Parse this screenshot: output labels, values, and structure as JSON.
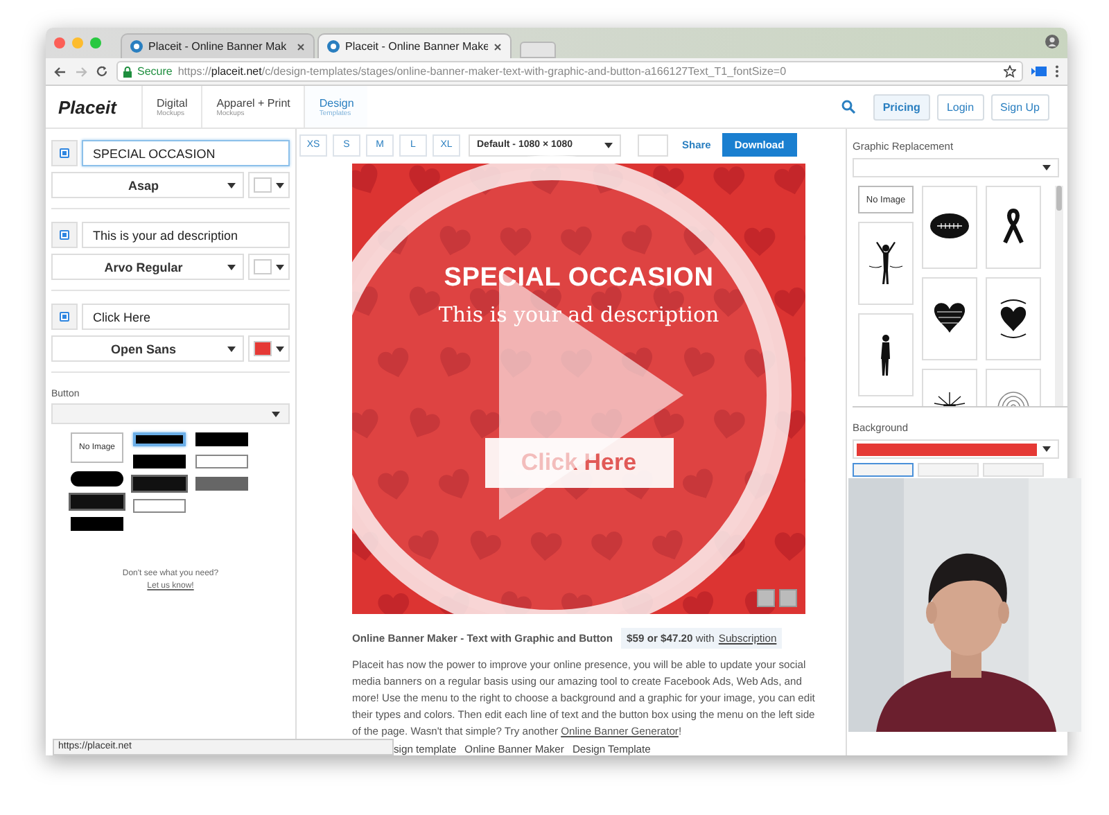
{
  "browser": {
    "tabs": [
      {
        "title": "Placeit - Online Banner Mak",
        "selected": false
      },
      {
        "title": "Placeit - Online Banner Make",
        "selected": true
      }
    ],
    "secure_label": "Secure",
    "url": "https://**placeit.net**/c/design-templates/stages/online-banner-maker-text-with-graphic-and-button-a166127Text_T1_fontSize=0"
  },
  "header": {
    "logo": "Placeit",
    "nav": [
      {
        "title": "Digital",
        "subtitle": "Mockups",
        "selected": false
      },
      {
        "title": "Apparel + Print",
        "subtitle": "Mockups",
        "selected": false
      },
      {
        "title": "Design",
        "subtitle": "Templates",
        "selected": true
      }
    ],
    "buttons": [
      {
        "label": "Pricing",
        "highlighted": true
      },
      {
        "label": "Login",
        "highlighted": false
      },
      {
        "label": "Sign Up",
        "highlighted": false
      }
    ]
  },
  "text_layers": [
    {
      "checked": true,
      "text": "SPECIAL OCCASION",
      "focused": true,
      "font": "Asap",
      "color": "#ffffff"
    },
    {
      "checked": true,
      "text": "This is your ad description",
      "focused": false,
      "font": "Arvo Regular",
      "color": "#ffffff"
    },
    {
      "checked": true,
      "text": "Click Here",
      "focused": false,
      "font": "Open Sans",
      "color": "#e53935"
    }
  ],
  "button_panel": {
    "label": "Button",
    "columns": [
      [
        {
          "kind": "no-image",
          "text": "No Image",
          "selected": false
        },
        {
          "kind": "pill",
          "selected": false
        },
        {
          "kind": "shadow",
          "selected": false
        },
        {
          "kind": "solid",
          "selected": false
        }
      ],
      [
        {
          "kind": "solid",
          "selected": true
        },
        {
          "kind": "solid",
          "selected": false
        },
        {
          "kind": "shadow",
          "selected": false
        },
        {
          "kind": "outline",
          "selected": false
        }
      ],
      [
        {
          "kind": "solid",
          "selected": false
        },
        {
          "kind": "outline",
          "selected": false
        },
        {
          "kind": "gray",
          "selected": false
        }
      ]
    ],
    "help_text": "Don't see what you need?",
    "help_link": "Let us know!"
  },
  "toolbar": {
    "sizes": [
      "XS",
      "S",
      "M",
      "L",
      "XL"
    ],
    "canvas_size": "Default - 1080 × 1080",
    "share": "Share",
    "download": "Download"
  },
  "banner": {
    "headline": "SPECIAL OCCASION",
    "description": "This is your ad description",
    "button": "Click Here"
  },
  "product": {
    "title": "Online Banner Maker - Text with Graphic and Button",
    "price": "**$59 or $47.20** with",
    "price_link": "Subscription",
    "description": "Placeit has now the power to improve your online presence, you will be able to update your social media banners on a regular basis using our amazing tool to create Facebook Ads, Web Ads, and more! Use the menu to the right to choose a background and a graphic for your image, you can edit their types and colors. Then edit each line of text and the button box using the menu on the left side of the page. Wasn't that simple? Try another ",
    "description_link": "Online Banner Generator",
    "description_end": "!",
    "tags": [
      "sign template",
      "Online Banner Maker",
      "Design Template"
    ]
  },
  "right_panel": {
    "graphic_label": "Graphic Replacement",
    "graphic_columns": [
      [
        {
          "kind": "no-image",
          "text": "No Image",
          "selected": false
        },
        {
          "kind": "runner-arms-up",
          "selected": false
        },
        {
          "kind": "runner",
          "selected": false
        }
      ],
      [
        {
          "kind": "football",
          "selected": false
        },
        {
          "kind": "scribble-heart",
          "selected": false
        },
        {
          "kind": "sunburst",
          "selected": false
        }
      ],
      [
        {
          "kind": "ribbon",
          "selected": false
        },
        {
          "kind": "heart-arrows",
          "selected": false
        },
        {
          "kind": "fingerprint",
          "selected": false
        }
      ]
    ],
    "background_label": "Background",
    "background_swatch": {
      "color": "#e53935"
    },
    "swatches": [
      {
        "selected": true
      },
      {
        "selected": false
      },
      {
        "selected": false
      }
    ]
  },
  "status_bar": "https://placeit.net"
}
